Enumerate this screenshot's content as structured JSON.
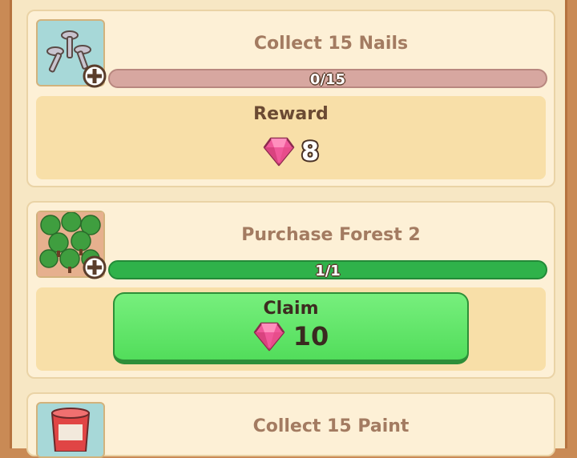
{
  "tasks": [
    {
      "title": "Collect 15 Nails",
      "icon": "nails-icon",
      "progress_text": "0/15",
      "progress_fraction": 0,
      "reward_label": "Reward",
      "reward_value": "8",
      "colors": {
        "bar_bg": "#d7a7a0",
        "bar_fill": "#d7a7a0"
      }
    },
    {
      "title": "Purchase Forest 2",
      "icon": "forest-icon",
      "progress_text": "1/1",
      "progress_fraction": 1,
      "claim_label": "Claim",
      "claim_value": "10",
      "colors": {
        "bar_bg": "#2fb24a",
        "bar_fill": "#2fb24a",
        "button": "#5fe367"
      }
    },
    {
      "title": "Collect 15 Paint",
      "icon": "paint-bucket-icon"
    }
  ],
  "colors": {
    "background": "#c98a55",
    "panel": "#f7e7c4",
    "card": "#fdf0d6",
    "gem": "#f0589a"
  }
}
